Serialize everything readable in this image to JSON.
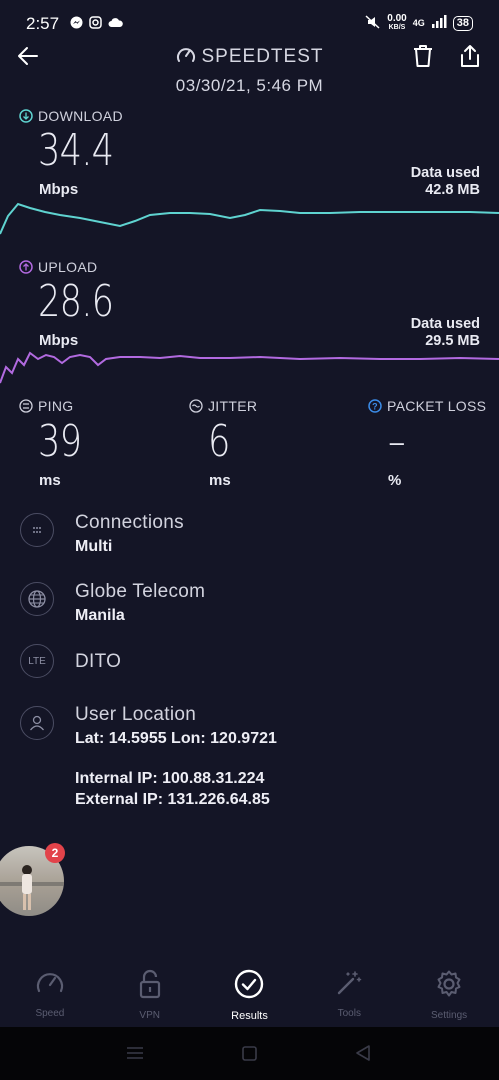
{
  "status_bar": {
    "time": "2:57",
    "net_speed_value": "0.00",
    "net_speed_unit": "KB/S",
    "network": "4G",
    "battery": "38"
  },
  "header": {
    "title": "SPEEDTEST",
    "date": "03/30/21, 5:46 PM"
  },
  "download": {
    "label": "DOWNLOAD",
    "value": "34.4",
    "unit": "Mbps",
    "data_used_label": "Data used",
    "data_used_value": "42.8 MB",
    "color": "#5fd3d0"
  },
  "upload": {
    "label": "UPLOAD",
    "value": "28.6",
    "unit": "Mbps",
    "data_used_label": "Data used",
    "data_used_value": "29.5 MB",
    "color": "#b26ae0"
  },
  "ping": {
    "label": "PING",
    "value": "39",
    "unit": "ms"
  },
  "jitter": {
    "label": "JITTER",
    "value": "6",
    "unit": "ms"
  },
  "packet_loss": {
    "label": "PACKET LOSS",
    "value": "–",
    "unit": "%"
  },
  "info": {
    "connections": {
      "title": "Connections",
      "value": "Multi"
    },
    "provider": {
      "title": "Globe Telecom",
      "value": "Manila"
    },
    "server": {
      "icon_text": "LTE",
      "title": "DITO"
    },
    "location": {
      "title": "User Location",
      "coords": "Lat: 14.5955 Lon: 120.9721",
      "internal_ip": "Internal IP: 100.88.31.224",
      "external_ip": "External IP: 131.226.64.85"
    }
  },
  "bubble": {
    "badge": "2"
  },
  "nav": {
    "speed": "Speed",
    "vpn": "VPN",
    "results": "Results",
    "tools": "Tools",
    "settings": "Settings"
  }
}
